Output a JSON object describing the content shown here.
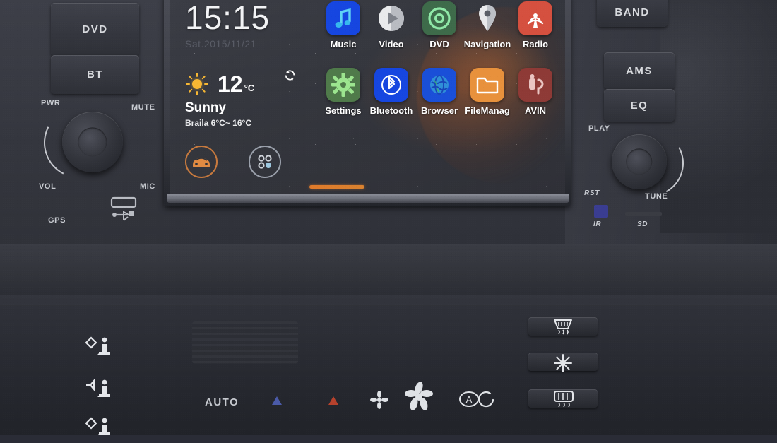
{
  "screen": {
    "clock": "15:15",
    "date": "Sat.2015/11/21",
    "weather": {
      "icon": "sun-icon",
      "temperature": "12",
      "unit": "°C",
      "condition": "Sunny",
      "range": "Braila 6°C~ 16°C",
      "refresh_icon": "refresh-icon"
    },
    "dock": [
      {
        "name": "car-info-button",
        "icon": "car-icon",
        "color": "#c87a3e"
      },
      {
        "name": "all-apps-button",
        "icon": "apps-grid-icon",
        "color": "#9aa0ab"
      }
    ],
    "apps_row1": [
      {
        "label": "Music",
        "icon": "music-note-icon",
        "bg": "#1646e0"
      },
      {
        "label": "Video",
        "icon": "play-circle-icon",
        "bg": "#3a3c44"
      },
      {
        "label": "DVD",
        "icon": "disc-icon",
        "bg": "#3e6b4a"
      },
      {
        "label": "Navigation",
        "icon": "map-pin-icon",
        "bg": "#3a3c44"
      },
      {
        "label": "Radio",
        "icon": "broadcast-icon",
        "bg": "#d5503f"
      }
    ],
    "apps_row2": [
      {
        "label": "Settings",
        "icon": "gear-icon",
        "bg": "#4f7a4a"
      },
      {
        "label": "Bluetooth",
        "icon": "bluetooth-icon",
        "bg": "#1646e0"
      },
      {
        "label": "Browser",
        "icon": "globe-icon",
        "bg": "#1a4fd8"
      },
      {
        "label": "FileManag",
        "icon": "folder-icon",
        "bg": "#e8913c"
      },
      {
        "label": "AVIN",
        "icon": "av-input-icon",
        "bg": "#8e3a36"
      }
    ],
    "page_indicator": {
      "name": "page-indicator",
      "color": "#e07a2a"
    }
  },
  "left_panel": {
    "buttons": [
      {
        "label": "DVD",
        "name": "dvd-button"
      },
      {
        "label": "BT",
        "name": "bt-button"
      }
    ],
    "labels": {
      "pwr": "PWR",
      "mute": "MUTE",
      "vol": "VOL",
      "mic": "MIC",
      "gps": "GPS"
    },
    "knob": "volume-knob",
    "usb_icon": "usb-port-icon"
  },
  "right_panel": {
    "buttons": [
      {
        "label": "BAND",
        "name": "band-button"
      },
      {
        "label": "AMS",
        "name": "ams-button"
      },
      {
        "label": "EQ",
        "name": "eq-button"
      }
    ],
    "labels": {
      "play": "PLAY",
      "tune": "TUNE",
      "rst": "RST",
      "ir": "IR",
      "sd": "SD"
    },
    "knob": "tune-knob"
  },
  "climate_panel": {
    "auto_label": "AUTO",
    "airflow_buttons": [
      {
        "name": "airflow-face-button",
        "icon": "seat-face-vent-icon"
      },
      {
        "name": "airflow-body-button",
        "icon": "seat-body-vent-icon"
      },
      {
        "name": "airflow-floor-button",
        "icon": "seat-floor-vent-icon"
      }
    ],
    "temp_markers": [
      {
        "name": "cold-marker",
        "color": "#4a5aa8"
      },
      {
        "name": "hot-marker",
        "color": "#b5412c"
      }
    ],
    "fan_buttons": [
      {
        "name": "fan-low-button",
        "icon": "fan-small-icon"
      },
      {
        "name": "fan-high-button",
        "icon": "fan-large-icon"
      }
    ],
    "recirc_button": {
      "name": "recirculation-button",
      "icon": "auto-recirc-icon"
    },
    "right_buttons": [
      {
        "name": "front-defrost-button",
        "icon": "windshield-defrost-icon"
      },
      {
        "name": "ac-button",
        "icon": "snowflake-icon"
      },
      {
        "name": "rear-defrost-button",
        "icon": "rear-defrost-icon"
      }
    ]
  }
}
